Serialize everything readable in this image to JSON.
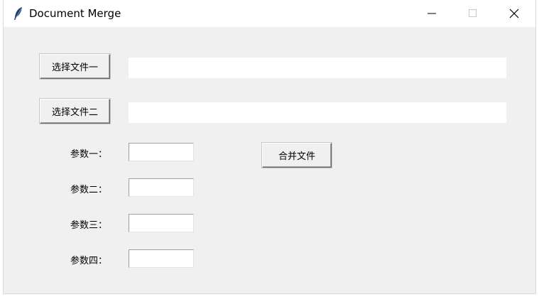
{
  "window": {
    "title": "Document Merge"
  },
  "buttons": {
    "select_file_one": "选择文件一",
    "select_file_two": "选择文件二",
    "merge": "合并文件"
  },
  "fields": {
    "file_one_path": "",
    "file_two_path": "",
    "param_one": "",
    "param_two": "",
    "param_three": "",
    "param_four": ""
  },
  "labels": {
    "param_one": "参数一：",
    "param_two": "参数二：",
    "param_three": "参数三：",
    "param_four": "参数四："
  },
  "icons": {
    "app": "feather-icon",
    "minimize": "minimize-icon",
    "maximize": "maximize-icon",
    "close": "close-icon"
  }
}
